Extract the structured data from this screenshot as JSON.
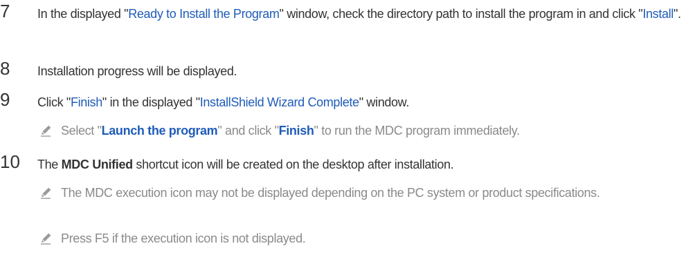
{
  "steps": [
    {
      "number": "7",
      "segments": [
        {
          "text": "In the displayed \"",
          "style": "plain"
        },
        {
          "text": "Ready to Install the Program",
          "style": "highlight"
        },
        {
          "text": "\" window, check the directory path to install the program in and click \"",
          "style": "plain"
        },
        {
          "text": "Install",
          "style": "highlight"
        },
        {
          "text": "\".",
          "style": "plain"
        }
      ]
    },
    {
      "number": "8",
      "segments": [
        {
          "text": "Installation progress will be displayed.",
          "style": "plain"
        }
      ]
    },
    {
      "number": "9",
      "segments": [
        {
          "text": "Click \"",
          "style": "plain"
        },
        {
          "text": "Finish",
          "style": "highlight"
        },
        {
          "text": "\" in the displayed \"",
          "style": "plain"
        },
        {
          "text": "InstallShield Wizard Complete",
          "style": "highlight"
        },
        {
          "text": "\" window.",
          "style": "plain"
        }
      ],
      "notes": [
        {
          "icon": "pencil-icon",
          "segments": [
            {
              "text": "Select \"",
              "style": "plain"
            },
            {
              "text": "Launch the program",
              "style": "highlight-bold"
            },
            {
              "text": "\" and click \"",
              "style": "plain"
            },
            {
              "text": "Finish",
              "style": "highlight-bold"
            },
            {
              "text": "\" to run the MDC program immediately.",
              "style": "plain"
            }
          ]
        }
      ]
    },
    {
      "number": "10",
      "segments": [
        {
          "text": "The ",
          "style": "plain"
        },
        {
          "text": "MDC Unified",
          "style": "bold"
        },
        {
          "text": " shortcut icon will be created on the desktop after installation.",
          "style": "plain"
        }
      ],
      "notes": [
        {
          "icon": "pencil-icon",
          "segments": [
            {
              "text": "The MDC execution icon may not be displayed depending on the PC system or product specifications.",
              "style": "plain"
            }
          ]
        },
        {
          "icon": "pencil-icon",
          "segments": [
            {
              "text": "Press F5 if the execution icon is not displayed.",
              "style": "plain"
            }
          ]
        }
      ]
    }
  ],
  "colors": {
    "text": "#333333",
    "highlight": "#1f5cb8",
    "note_text": "#8a8a8a",
    "icon": "#9a9a9a"
  }
}
